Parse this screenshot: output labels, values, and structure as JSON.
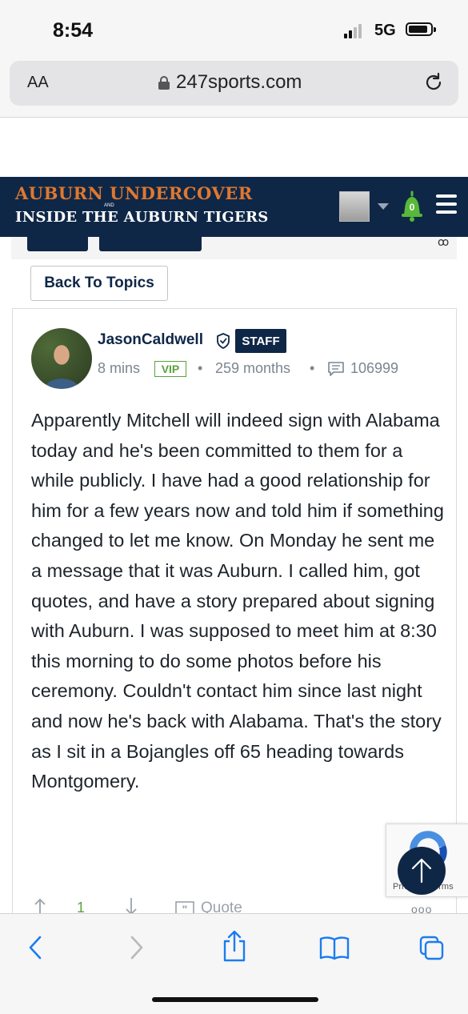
{
  "status_bar": {
    "time": "8:54",
    "network": "5G"
  },
  "browser": {
    "text_size_label": "AA",
    "url": "247sports.com"
  },
  "site": {
    "brand_line1": "AUBURN UNDERCOVER",
    "brand_and": "AND",
    "brand_line2": "INSIDE THE AUBURN TIGERS",
    "notification_count": "0"
  },
  "nav": {
    "back_label": "Back To Topics"
  },
  "post": {
    "author": "JasonCaldwell",
    "role_badge": "STAFF",
    "posted_ago": "8 mins",
    "tier_badge": "VIP",
    "membership": "259 months",
    "post_count": "106999",
    "body": "Apparently Mitchell will indeed sign with Alabama today and he's been committed to them for a while publicly. I have had a good relationship for him for a few years now and told him if something changed to let me know. On Monday he sent me a message that it was Auburn. I called him, got quotes, and have a story prepared about signing with Auburn. I was supposed to meet him at 8:30 this morning to do some photos before his ceremony. Couldn't contact him since last night and now he's back with Alabama. That's the story as I sit in a Bojangles off 65 heading towards Montgomery.",
    "upvotes": "1",
    "quote_label": "Quote"
  },
  "recaptcha": {
    "text": "Privacy - Terms"
  },
  "colors": {
    "navy": "#0f2747",
    "orange": "#e0782e",
    "green": "#5aa23c",
    "ios_blue": "#1a7cf0"
  },
  "icons": [
    "lock-icon",
    "reload-icon",
    "bell-icon",
    "menu-icon",
    "shield-check-icon",
    "comment-icon",
    "arrow-up-icon",
    "arrow-down-icon",
    "quote-icon",
    "more-icon",
    "back-icon",
    "forward-icon",
    "share-icon",
    "bookmarks-icon",
    "tabs-icon"
  ]
}
